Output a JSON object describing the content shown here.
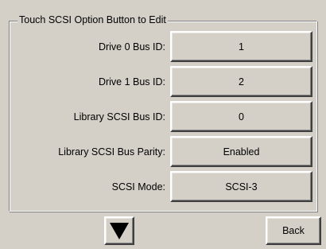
{
  "group": {
    "title": "Touch SCSI Option Button to Edit"
  },
  "options": [
    {
      "label": "Drive 0 Bus ID:",
      "value": "1"
    },
    {
      "label": "Drive 1 Bus ID:",
      "value": "2"
    },
    {
      "label": "Library SCSI Bus ID:",
      "value": "0"
    },
    {
      "label": "Library SCSI Bus Parity:",
      "value": "Enabled"
    },
    {
      "label": "SCSI Mode:",
      "value": "SCSI-3"
    }
  ],
  "footer": {
    "back_label": "Back",
    "down_icon": "triangle-down-icon"
  },
  "colors": {
    "background": "#d4d0c8",
    "icon": "#000000"
  }
}
